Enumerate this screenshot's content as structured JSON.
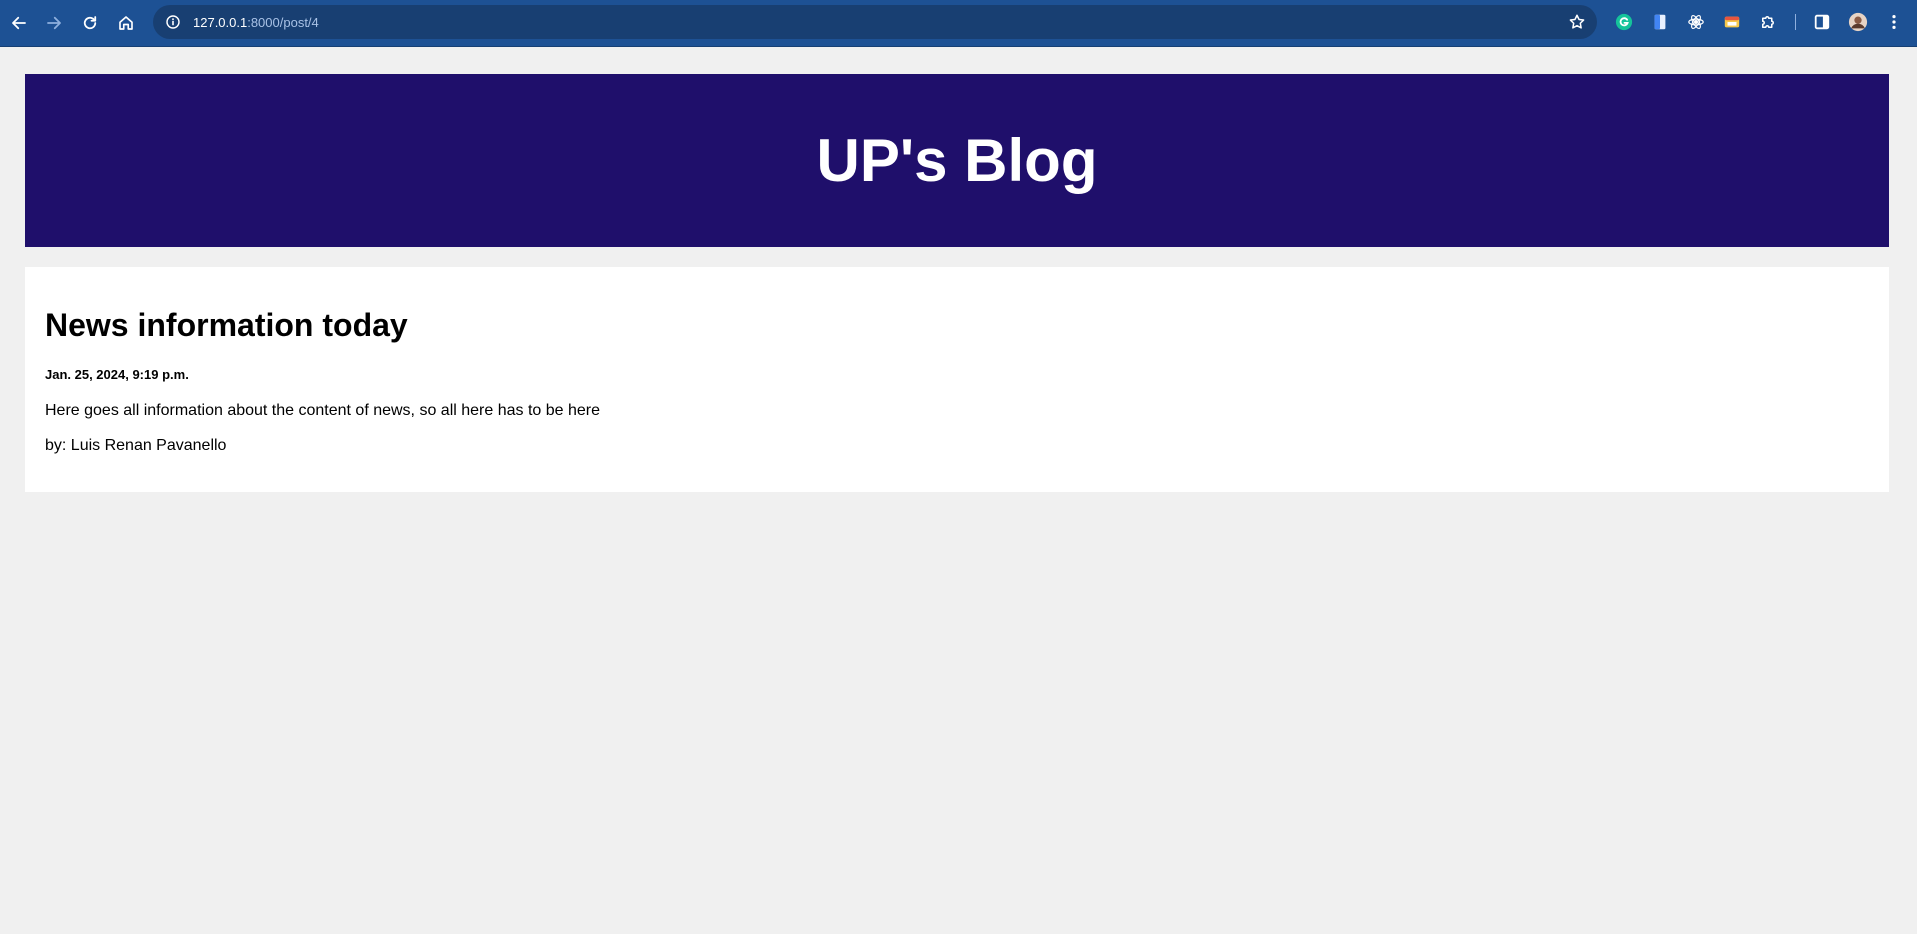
{
  "browser": {
    "url_host": "127.0.0.1",
    "url_path": ":8000/post/4",
    "icons": {
      "back": "back-arrow-icon",
      "forward": "forward-arrow-icon",
      "reload": "reload-icon",
      "home": "home-icon",
      "site_info": "info-icon",
      "bookmark": "star-icon",
      "extensions": [
        "grammarly-icon",
        "docs-extension-icon",
        "react-devtools-icon",
        "window-extension-icon",
        "puzzle-icon"
      ],
      "side_panel": "side-panel-icon",
      "profile": "avatar",
      "menu": "kebab-menu-icon"
    }
  },
  "header": {
    "title": "UP's Blog",
    "background": "#1f0f6b"
  },
  "post": {
    "title": "News information today",
    "date": "Jan. 25, 2024, 9:19 p.m.",
    "body": "Here goes all information about the content of news, so all here has to be here",
    "author": "by: Luis Renan Pavanello"
  }
}
